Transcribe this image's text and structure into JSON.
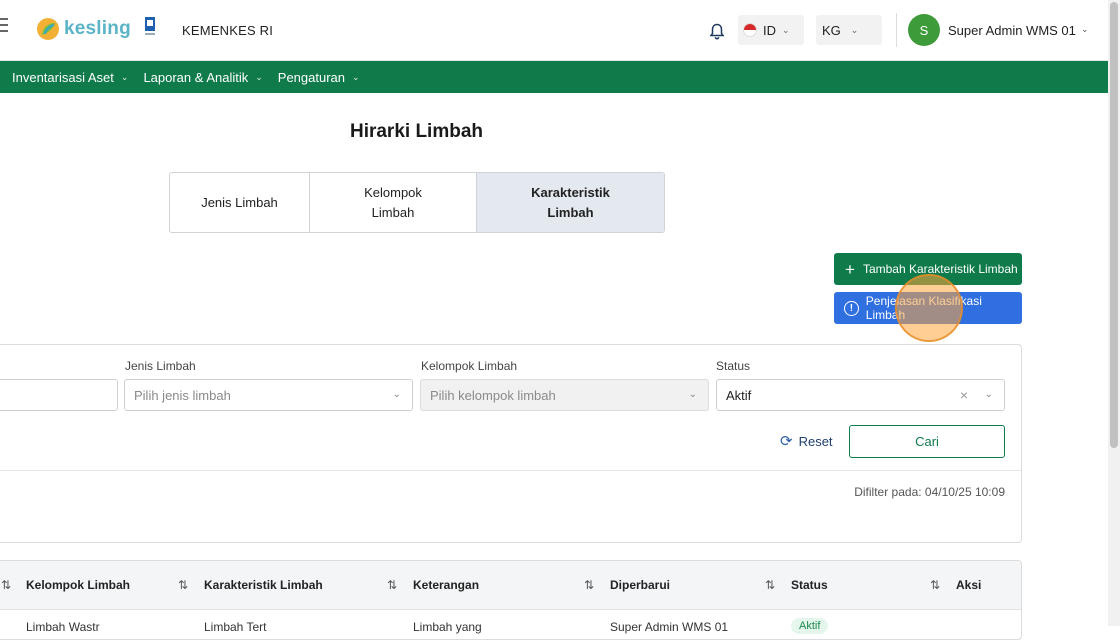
{
  "header": {
    "brand": "kesling",
    "org": "KEMENKES RI",
    "language": "ID",
    "unit": "KG",
    "avatar_initial": "S",
    "username": "Super Admin WMS 01"
  },
  "nav": {
    "items": [
      {
        "label": "Inventarisasi Aset"
      },
      {
        "label": "Laporan & Analitik"
      },
      {
        "label": "Pengaturan"
      }
    ]
  },
  "page": {
    "title": "Hirarki Limbah",
    "tabs": [
      {
        "label": "Jenis Limbah",
        "active": false
      },
      {
        "label": "Kelompok Limbah",
        "active": false
      },
      {
        "label": "Karakteristik Limbah",
        "active": true
      }
    ],
    "add_button": "Tambah Karakteristik Limbah",
    "info_button": "Penjelasan Klasifikasi Limbah"
  },
  "filter": {
    "jenis_label": "Jenis Limbah",
    "jenis_placeholder": "Pilih jenis limbah",
    "kelompok_label": "Kelompok Limbah",
    "kelompok_placeholder": "Pilih kelompok limbah",
    "status_label": "Status",
    "status_value": "Aktif",
    "reset_label": "Reset",
    "search_label": "Cari",
    "filtered_at": "Difilter pada: 04/10/25 10:09"
  },
  "table": {
    "columns": [
      "Kelompok Limbah",
      "Karakteristik Limbah",
      "Keterangan",
      "Diperbarui",
      "Status",
      "Aksi"
    ],
    "rows": [
      {
        "kelompok": "Limbah Wastr",
        "karakteristik": "Limbah Tert",
        "keterangan": "Limbah yang",
        "diperbarui": "Super Admin WMS 01",
        "status": "Aktif"
      }
    ]
  },
  "colors": {
    "primary": "#0f7a4a",
    "info": "#2f6fe0",
    "active_tab": "#e4e9f0"
  }
}
